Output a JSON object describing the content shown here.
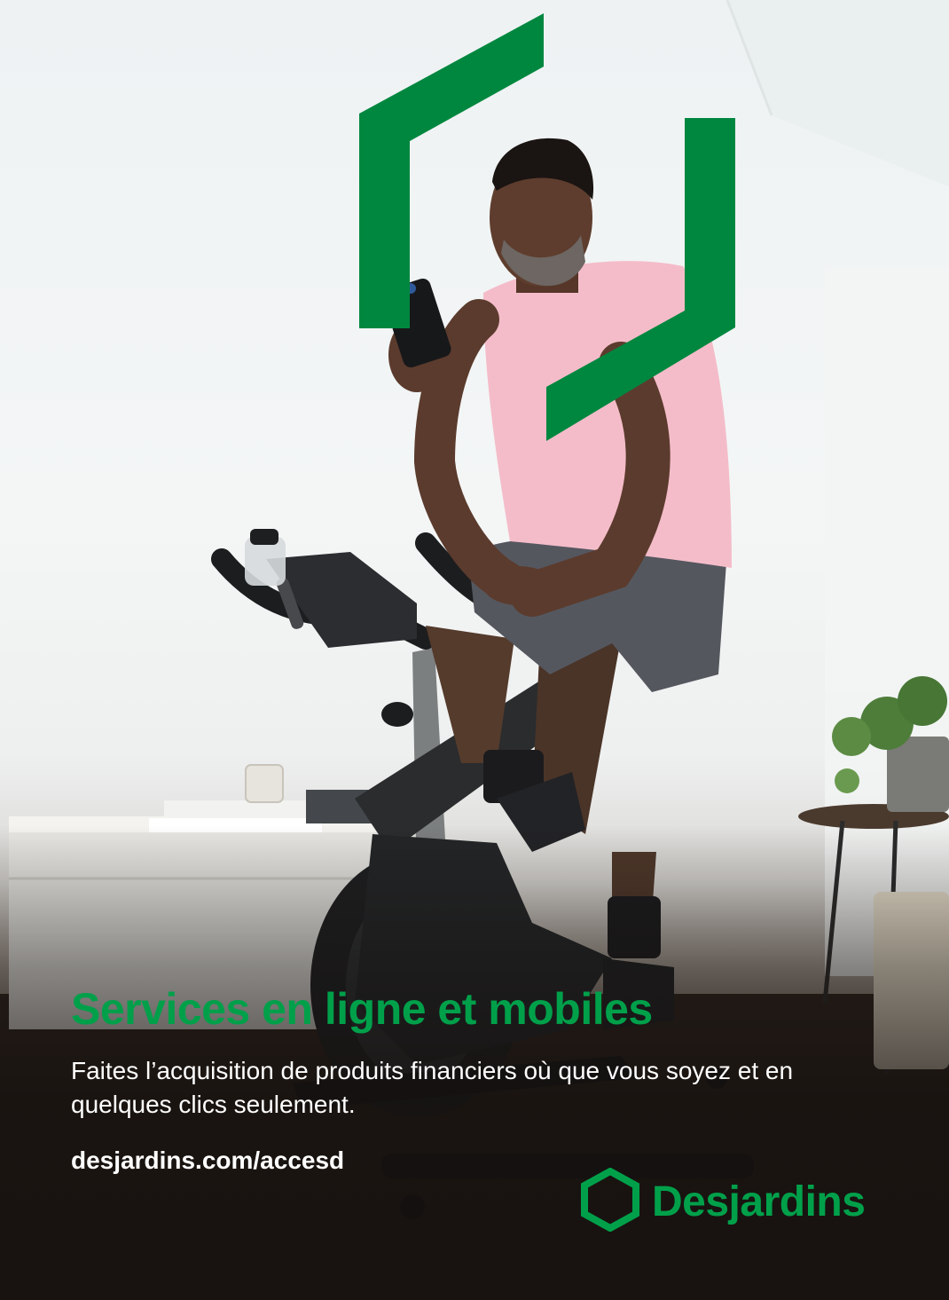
{
  "ad": {
    "headline": "Services en ligne et mobiles",
    "body": "Faites l’acquisition de produits financiers où que vous soyez et en quelques clics seulement.",
    "url": "desjardins.com/accesd",
    "brand_name": "Desjardins"
  },
  "colors": {
    "brand_green": "#00a04a",
    "text_white": "#ffffff"
  },
  "icons": [
    "desjardins-hexagon-icon",
    "bracket-graphic"
  ]
}
